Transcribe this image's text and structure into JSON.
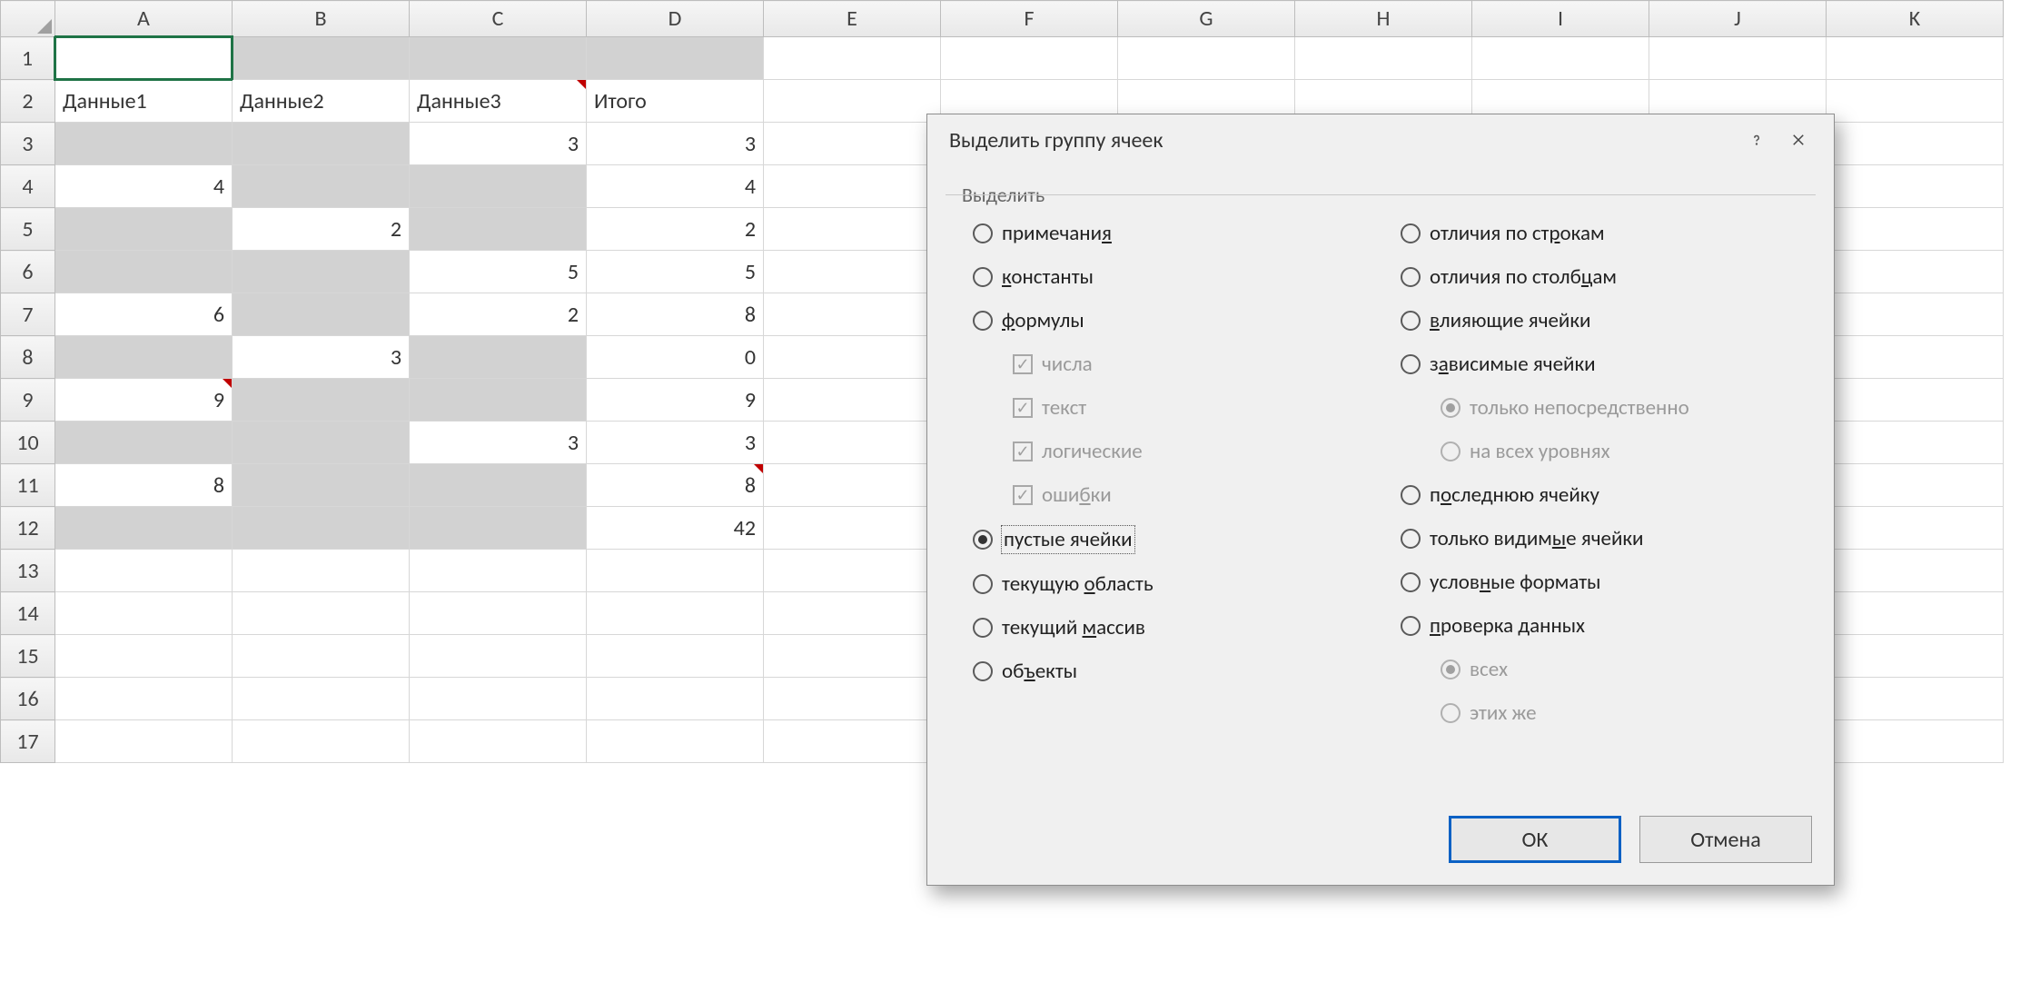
{
  "columns": [
    "A",
    "B",
    "C",
    "D",
    "E",
    "F",
    "G",
    "H",
    "I",
    "J",
    "K"
  ],
  "rowCount": 17,
  "activeCell": "A1",
  "selectionBox": {
    "startRow": 1,
    "endRow": 12,
    "startCol": 1,
    "endCol": 4
  },
  "headers": {
    "A": "Данные1",
    "B": "Данные2",
    "C": "Данные3",
    "D": "Итого"
  },
  "data": {
    "3": {
      "C": 3,
      "D": 3
    },
    "4": {
      "A": 4,
      "D": 4
    },
    "5": {
      "B": 2,
      "D": 2
    },
    "6": {
      "C": 5,
      "D": 5
    },
    "7": {
      "A": 6,
      "C": 2,
      "D": 8
    },
    "8": {
      "B": 3,
      "D": 0
    },
    "9": {
      "A": 9,
      "D": 9
    },
    "10": {
      "C": 3,
      "D": 3
    },
    "11": {
      "A": 8,
      "D": 8
    },
    "12": {
      "D": 42
    }
  },
  "commentCells": [
    "C2",
    "A9",
    "D11"
  ],
  "grayCells": [
    "B1",
    "C1",
    "D1",
    "A3",
    "B3",
    "B4",
    "C4",
    "A5",
    "C5",
    "A6",
    "B6",
    "B7",
    "A8",
    "C8",
    "B9",
    "C9",
    "A10",
    "B10",
    "B11",
    "C11",
    "A12",
    "B12",
    "C12"
  ],
  "dialog": {
    "title": "Выделить группу ячеек",
    "frameLabel": "Выделить",
    "selected": "blanks",
    "left": [
      {
        "id": "comments",
        "type": "radio",
        "html": "примечани<span class='u'>я</span>"
      },
      {
        "id": "constants",
        "type": "radio",
        "html": "<span class='u'>к</span>онстанты"
      },
      {
        "id": "formulas",
        "type": "radio",
        "html": "<span class='u'>ф</span>ормулы"
      },
      {
        "id": "numbers",
        "type": "check",
        "sub": true,
        "disabled": true,
        "checked": true,
        "html": "числа"
      },
      {
        "id": "text",
        "type": "check",
        "sub": true,
        "disabled": true,
        "checked": true,
        "html": "текст"
      },
      {
        "id": "logicals",
        "type": "check",
        "sub": true,
        "disabled": true,
        "checked": true,
        "html": "логические"
      },
      {
        "id": "errors",
        "type": "check",
        "sub": true,
        "disabled": true,
        "checked": true,
        "html": "оши<span class='u'>б</span>ки"
      },
      {
        "id": "blanks",
        "type": "radio",
        "focus": true,
        "html": "пустые ячейки"
      },
      {
        "id": "region",
        "type": "radio",
        "html": "текущую <span class='u'>о</span>бласть"
      },
      {
        "id": "array",
        "type": "radio",
        "html": "текущий <span class='u'>м</span>ассив"
      },
      {
        "id": "objects",
        "type": "radio",
        "html": "об<span class='u'>ъ</span>екты"
      }
    ],
    "right": [
      {
        "id": "rowdiffs",
        "type": "radio",
        "html": "отличия по ст<span class='u'>р</span>окам"
      },
      {
        "id": "coldiffs",
        "type": "radio",
        "html": "отличия по столб<span class='u'>ц</span>ам"
      },
      {
        "id": "precedents",
        "type": "radio",
        "html": "<span class='u'>в</span>лияющие ячейки"
      },
      {
        "id": "dependents",
        "type": "radio",
        "html": "з<span class='u'>а</span>висимые ячейки"
      },
      {
        "id": "direct",
        "type": "radio",
        "sub": true,
        "disabled": true,
        "checked": true,
        "html": "только непосредственно"
      },
      {
        "id": "alllevels",
        "type": "radio",
        "sub": true,
        "disabled": true,
        "html": "на всех уровнях"
      },
      {
        "id": "lastcell",
        "type": "radio",
        "html": "п<span class='u'>о</span>следнюю ячейку"
      },
      {
        "id": "visible",
        "type": "radio",
        "html": "только видим<span class='u'>ы</span>е ячейки"
      },
      {
        "id": "condfmt",
        "type": "radio",
        "html": "услов<span class='u'>н</span>ые форматы"
      },
      {
        "id": "datavalid",
        "type": "radio",
        "html": "<span class='u'>п</span>роверка данных"
      },
      {
        "id": "dv_all",
        "type": "radio",
        "sub": true,
        "disabled": true,
        "checked": true,
        "html": "всех"
      },
      {
        "id": "dv_same",
        "type": "radio",
        "sub": true,
        "disabled": true,
        "html": "этих же"
      }
    ],
    "buttons": {
      "ok": "ОК",
      "cancel": "Отмена"
    }
  }
}
